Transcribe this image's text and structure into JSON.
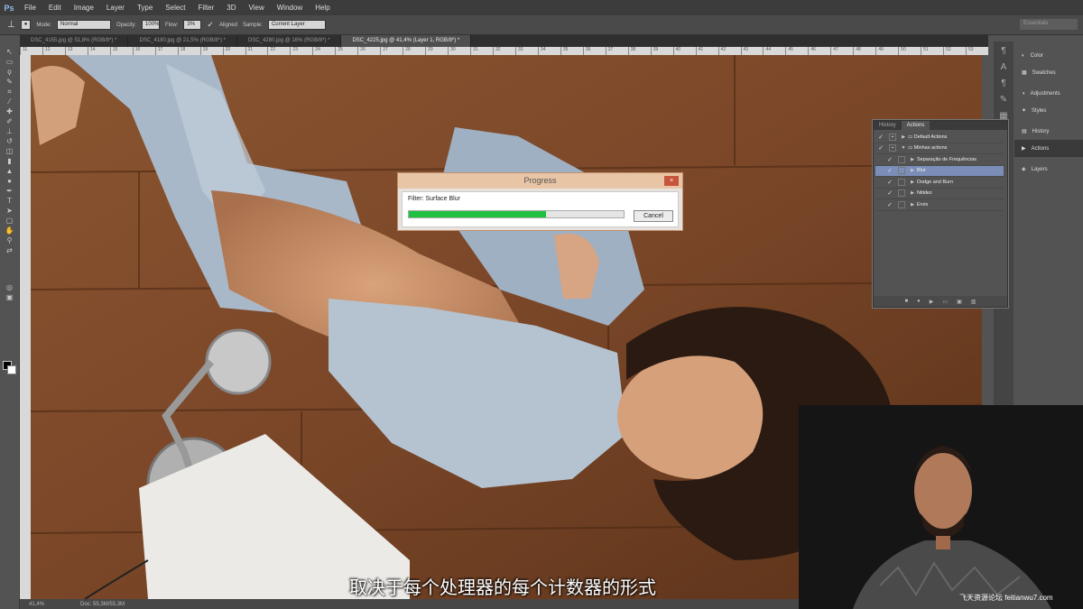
{
  "app": {
    "logo": "Ps"
  },
  "menu": [
    "File",
    "Edit",
    "Image",
    "Layer",
    "Type",
    "Select",
    "Filter",
    "3D",
    "View",
    "Window",
    "Help"
  ],
  "options": {
    "mode_label": "Mode:",
    "mode_value": "Normal",
    "opacity_label": "Opacity:",
    "opacity_value": "100%",
    "flow_label": "Flow:",
    "flow_value": "3%",
    "aligned_label": "Aligned",
    "sample_label": "Sample:",
    "sample_value": "Current Layer",
    "workspace": "Essentials"
  },
  "tabs": [
    {
      "label": "DSC_4155.jpg @ 51,8% (RGB/8*) *"
    },
    {
      "label": "DSC_4180.jpg @ 21,5% (RGB/8*) *"
    },
    {
      "label": "DSC_4280.jpg @ 16% (RGB/8*) *"
    },
    {
      "label": "DSC_4225.jpg @ 41,4% (Layer 1, RGB/8*) *"
    }
  ],
  "ruler_ticks": [
    "11",
    "12",
    "13",
    "14",
    "15",
    "16",
    "17",
    "18",
    "19",
    "20",
    "21",
    "22",
    "23",
    "24",
    "25",
    "26",
    "27",
    "28",
    "29",
    "30",
    "31",
    "32",
    "33",
    "34",
    "35",
    "36",
    "37",
    "38",
    "39",
    "40",
    "41",
    "42",
    "43",
    "44",
    "45",
    "46",
    "47",
    "48",
    "49",
    "50",
    "51",
    "52",
    "53"
  ],
  "status": {
    "zoom": "41,4%",
    "doc": "Doc: 55,3M/55,3M"
  },
  "dock": [
    {
      "label": "Color",
      "icon": "color-icon"
    },
    {
      "label": "Swatches",
      "icon": "swatches-icon"
    },
    {
      "label": "Adjustments",
      "icon": "adjustments-icon"
    },
    {
      "label": "Styles",
      "icon": "styles-icon"
    },
    {
      "label": "History",
      "icon": "history-icon"
    },
    {
      "label": "Actions",
      "icon": "actions-icon"
    },
    {
      "label": "Layers",
      "icon": "layers-icon"
    }
  ],
  "actions_panel": {
    "tabs": [
      "History",
      "Actions"
    ],
    "rows": [
      {
        "label": "Default Actions"
      },
      {
        "label": "Minhas actions"
      },
      {
        "label": "Separação de Frequências"
      },
      {
        "label": "Blur"
      },
      {
        "label": "Dodge and Burn"
      },
      {
        "label": "Nitidez"
      },
      {
        "label": "Ervis"
      }
    ]
  },
  "progress_dialog": {
    "title": "Progress",
    "filter_text": "Filter: Surface Blur",
    "progress": 0.64,
    "cancel_label": "Cancel",
    "close_label": "×"
  },
  "subtitle": "取决于每个处理器的每个计数器的形式",
  "watermark": "飞天资源论坛 feitianwu7.com",
  "colors": {
    "progress_fill": "#20c040",
    "selected_row": "#7a8eb8"
  }
}
